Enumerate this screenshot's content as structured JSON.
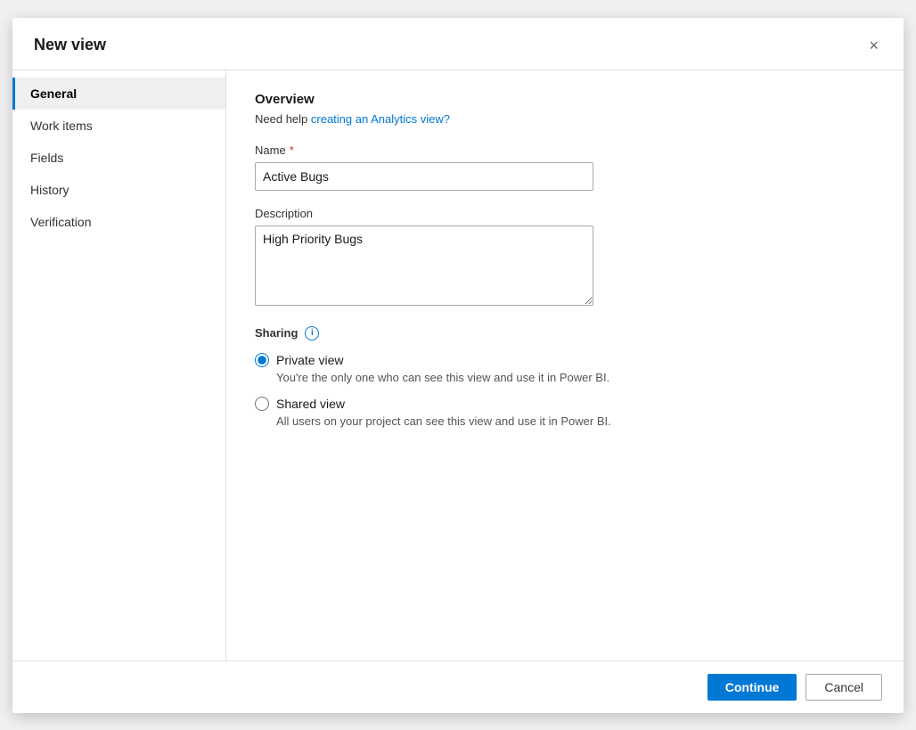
{
  "dialog": {
    "title": "New view",
    "close_label": "×"
  },
  "sidebar": {
    "items": [
      {
        "id": "general",
        "label": "General",
        "active": true
      },
      {
        "id": "work-items",
        "label": "Work items",
        "active": false
      },
      {
        "id": "fields",
        "label": "Fields",
        "active": false
      },
      {
        "id": "history",
        "label": "History",
        "active": false
      },
      {
        "id": "verification",
        "label": "Verification",
        "active": false
      }
    ]
  },
  "main": {
    "section_title": "Overview",
    "help_prefix": "Need help ",
    "help_link_text": "creating an Analytics view?",
    "name_label": "Name",
    "name_required": true,
    "name_value": "Active Bugs",
    "name_placeholder": "",
    "description_label": "Description",
    "description_value": "High Priority Bugs",
    "description_placeholder": "",
    "sharing_label": "Sharing",
    "private_view_label": "Private view",
    "private_view_desc": "You're the only one who can see this view and use it in Power BI.",
    "shared_view_label": "Shared view",
    "shared_view_desc": "All users on your project can see this view and use it in Power BI."
  },
  "footer": {
    "continue_label": "Continue",
    "cancel_label": "Cancel"
  }
}
